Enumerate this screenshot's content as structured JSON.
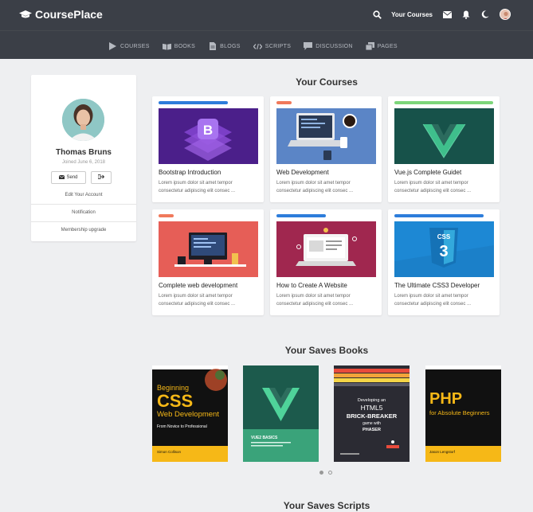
{
  "brand": {
    "name": "CoursePlace",
    "icon": "graduation-cap-icon"
  },
  "topbar": {
    "your_courses_label": "Your Courses"
  },
  "nav": [
    {
      "label": "COURSES",
      "icon": "play-icon"
    },
    {
      "label": "BOOKS",
      "icon": "book-icon"
    },
    {
      "label": "BLOGS",
      "icon": "file-icon"
    },
    {
      "label": "SCRIPTS",
      "icon": "code-icon"
    },
    {
      "label": "DISCUSSION",
      "icon": "comment-icon"
    },
    {
      "label": "PAGES",
      "icon": "copy-icon"
    }
  ],
  "profile": {
    "name": "Thomas Bruns",
    "joined": "Joined June 6, 2018",
    "send_label": "Send",
    "edit_label": "Edit Your Account",
    "notification_label": "Notification",
    "membership_label": "Membership upgrade"
  },
  "courses_section": {
    "title": "Your Courses"
  },
  "courses": [
    {
      "title": "Bootstrap Introduction",
      "desc1": "Lorem ipsum dolor sit amet tempor",
      "desc2": "consectetur adipiscing elit consec ...",
      "bar_color": "#2d7ddb",
      "progress": 0.7
    },
    {
      "title": "Web Development",
      "desc1": "Lorem ipsum dolor sit amet tempor",
      "desc2": "consectetur adipiscing elit consec ...",
      "bar_color": "#f0795b",
      "progress": 0.15
    },
    {
      "title": "Vue.js Complete Guidet",
      "desc1": "Lorem ipsum dolor sit amet tempor",
      "desc2": "consectetur adipiscing elit consec ...",
      "bar_color": "#7dd67a",
      "progress": 1.0
    },
    {
      "title": "Complete web development",
      "desc1": "Lorem ipsum dolor sit amet tempor",
      "desc2": "consectetur adipiscing elit consec ...",
      "bar_color": "#f0795b",
      "progress": 0.15
    },
    {
      "title": "How to Create A Website",
      "desc1": "Lorem ipsum dolor sit amet tempor",
      "desc2": "consectetur adipiscing elit consec ...",
      "bar_color": "#2d7ddb",
      "progress": 0.5
    },
    {
      "title": "The Ultimate CSS3 Developer",
      "desc1": "Lorem ipsum dolor sit amet tempor",
      "desc2": "consectetur adipiscing elit consec ...",
      "bar_color": "#2d7ddb",
      "progress": 0.9
    }
  ],
  "books_section": {
    "title": "Your Saves Books"
  },
  "books": [
    {
      "line1": "Beginning",
      "line2": "CSS",
      "line3": "Web Development",
      "line4": "From Novice to Professional",
      "author": "Simon Collison"
    },
    {
      "line1": "VUE2 BASICS",
      "author": ""
    },
    {
      "line1": "Developing an",
      "line2": "HTML5",
      "line3": "BRICK-BREAKER",
      "line4": "game with",
      "line5": "PHASER"
    },
    {
      "line1": "PHP",
      "line2": "for Absolute Beginners",
      "author": "Jason Lengstorf"
    }
  ],
  "scripts_section": {
    "title": "Your Saves Scripts"
  },
  "colors": {
    "header": "#3b3f47",
    "background": "#eeeff1"
  }
}
